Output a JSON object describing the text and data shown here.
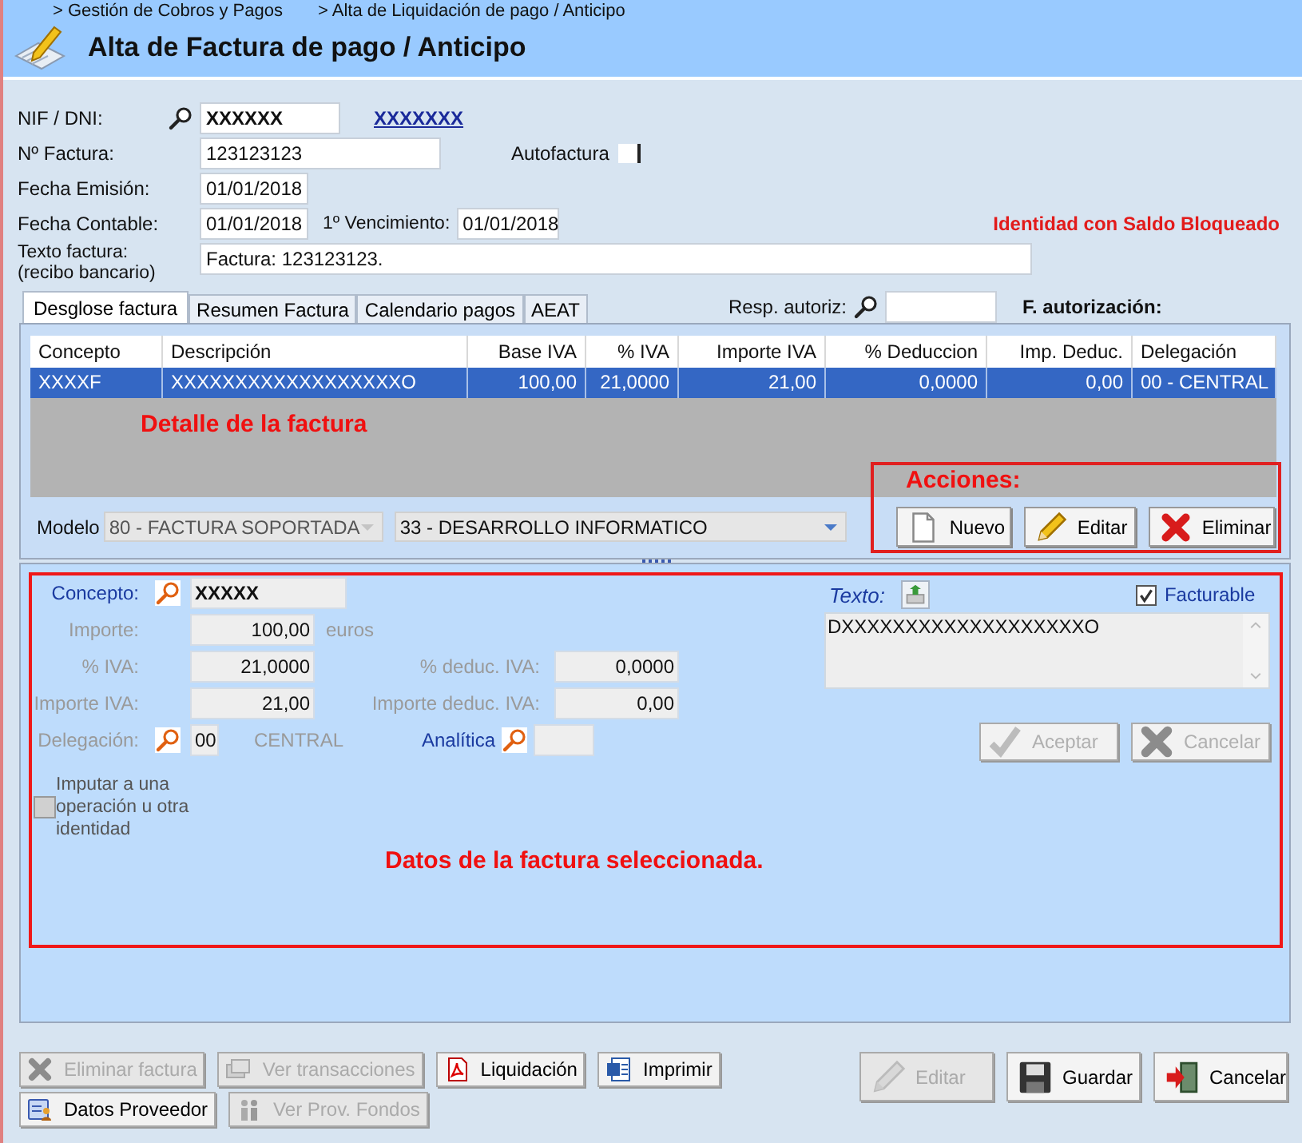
{
  "breadcrumbs": [
    "> Gestión de Cobros y Pagos",
    "> Alta de Liquidación de pago / Anticipo"
  ],
  "title": "Alta de Factura de pago / Anticipo",
  "nif": {
    "label": "NIF / DNI:",
    "value": "XXXXXX",
    "name": "XXXXXXX"
  },
  "invoice_number": {
    "label": "Nº Factura:",
    "value": "123123123"
  },
  "self_invoice": {
    "label": "Autofactura",
    "checked": false
  },
  "issue_date": {
    "label": "Fecha Emisión:",
    "value": "01/01/2018"
  },
  "accounting_date": {
    "label": "Fecha Contable:",
    "value": "01/01/2018"
  },
  "due_date": {
    "label": "1º Vencimiento:",
    "value": "01/01/2018"
  },
  "alert": "Identidad con Saldo Bloqueado",
  "invoice_text": {
    "label": "Texto factura:",
    "sublabel": "(recibo bancario)",
    "value": "Factura: 123123123."
  },
  "tabs": [
    {
      "label": "Desglose factura",
      "selected": true
    },
    {
      "label": "Resumen Factura",
      "selected": false
    },
    {
      "label": "Calendario pagos",
      "selected": false
    },
    {
      "label": "AEAT",
      "selected": false
    }
  ],
  "resp_autoriz": {
    "label": "Resp. autoriz:"
  },
  "f_autorizacion": "F. autorización:",
  "table": {
    "columns": [
      "Concepto",
      "Descripción",
      "Base IVA",
      "% IVA",
      "Importe IVA",
      "% Deduccion",
      "Imp. Deduc.",
      "Delegación"
    ],
    "rows": [
      {
        "selected": true,
        "cells": [
          "XXXXF",
          "XXXXXXXXXXXXXXXXXXO",
          "100,00",
          "21,0000",
          "21,00",
          "0,0000",
          "0,00",
          "00 - CENTRAL"
        ]
      }
    ]
  },
  "detail_note": "Detalle de la factura",
  "actions_note": "Acciones:",
  "modelo": {
    "label": "Modelo",
    "value": "80 - FACTURA SOPORTADA",
    "disabled": true
  },
  "department": {
    "value": "33 - DESARROLLO INFORMATICO"
  },
  "actions": [
    "Nuevo",
    "Editar",
    "Eliminar"
  ],
  "line": {
    "concept": {
      "label": "Concepto:",
      "value": "XXXXX",
      "disabled": false
    },
    "amount": {
      "label": "Importe:",
      "value": "100,00",
      "unit": "euros",
      "disabled": true
    },
    "vat_pct": {
      "label": "% IVA:",
      "value": "21,0000",
      "disabled": true
    },
    "vat_deduc_pct": {
      "label": "% deduc. IVA:",
      "value": "0,0000",
      "disabled": true
    },
    "vat_amount": {
      "label": "Importe IVA:",
      "value": "21,00",
      "disabled": true
    },
    "vat_deduc_amount": {
      "label": "Importe deduc. IVA:",
      "value": "0,00",
      "disabled": true
    },
    "delegation": {
      "label": "Delegación:",
      "code": "00",
      "name": "CENTRAL",
      "disabled": true
    },
    "analytics": {
      "label": "Analítica",
      "disabled": false
    },
    "impute": {
      "label": "Imputar a una operación u otra identidad",
      "checked": false
    },
    "text": {
      "label": "Texto:",
      "value": "DXXXXXXXXXXXXXXXXXXXO"
    },
    "billable": {
      "label": "Facturable",
      "checked": true
    },
    "buttons": [
      {
        "label": "Aceptar",
        "disabled": true
      },
      {
        "label": "Cancelar",
        "disabled": true
      }
    ]
  },
  "selected_note": "Datos de la factura seleccionada.",
  "footer_left": [
    [
      {
        "label": "Eliminar factura",
        "disabled": true
      },
      {
        "label": "Ver transacciones",
        "disabled": true
      },
      {
        "label": "Liquidación",
        "disabled": false
      },
      {
        "label": "Imprimir",
        "disabled": false
      }
    ],
    [
      {
        "label": "Datos Proveedor",
        "disabled": false
      },
      {
        "label": "Ver Prov. Fondos",
        "disabled": true
      }
    ]
  ],
  "footer_right": [
    {
      "label": "Editar",
      "disabled": true
    },
    {
      "label": "Guardar",
      "disabled": false
    },
    {
      "label": "Cancelar",
      "disabled": false
    }
  ]
}
